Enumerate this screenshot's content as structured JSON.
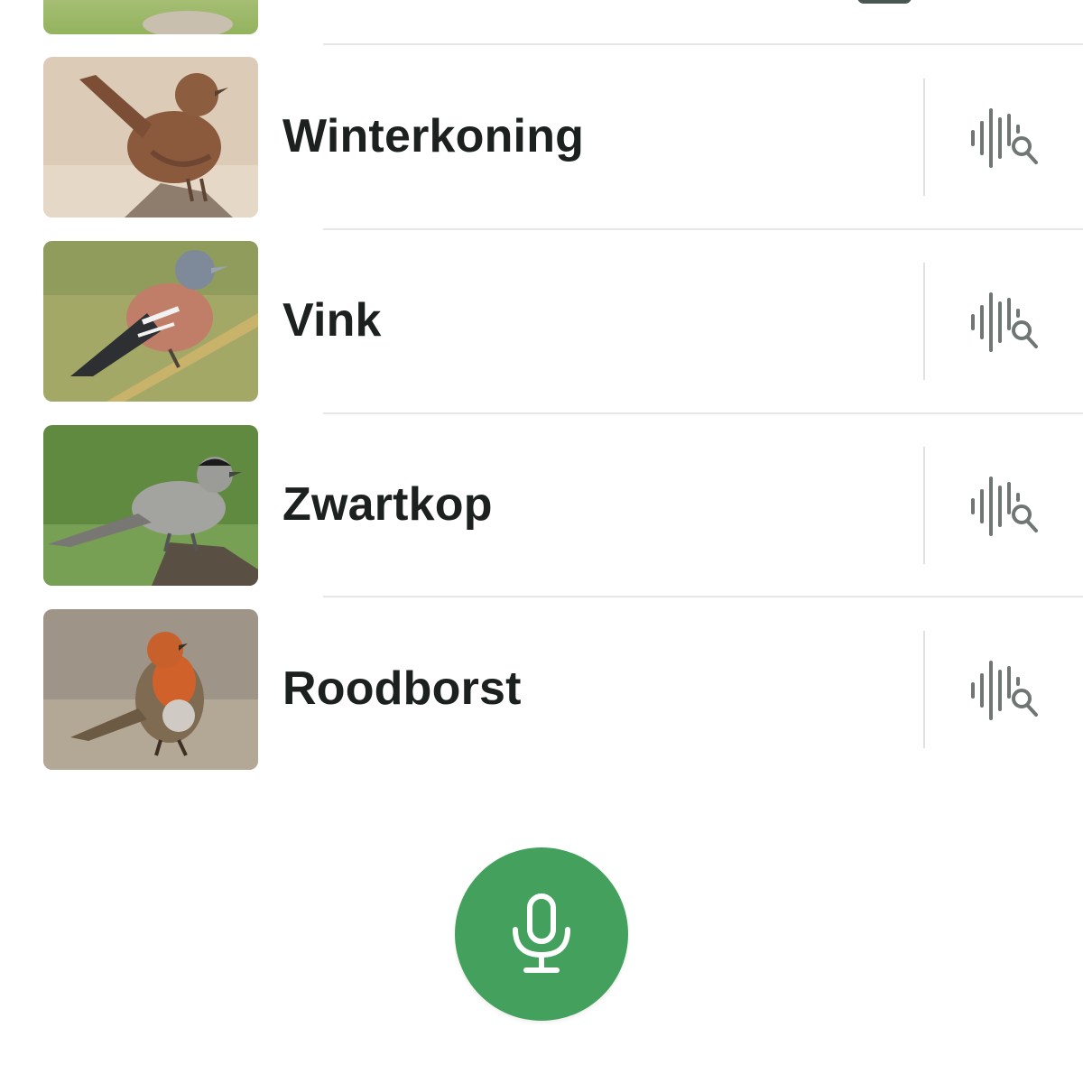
{
  "colors": {
    "accent": "#44a15d",
    "text": "#1c201f",
    "divider": "#e6e6e6",
    "icon": "#6f7673"
  },
  "birds": [
    {
      "name": "Winterkoning",
      "action_icon": "sound-search-icon",
      "photo": "winterkoning-photo"
    },
    {
      "name": "Vink",
      "action_icon": "sound-search-icon",
      "photo": "vink-photo"
    },
    {
      "name": "Zwartkop",
      "action_icon": "sound-search-icon",
      "photo": "zwartkop-photo"
    },
    {
      "name": "Roodborst",
      "action_icon": "sound-search-icon",
      "photo": "roodborst-photo"
    }
  ],
  "record_button": {
    "icon": "microphone-icon"
  }
}
